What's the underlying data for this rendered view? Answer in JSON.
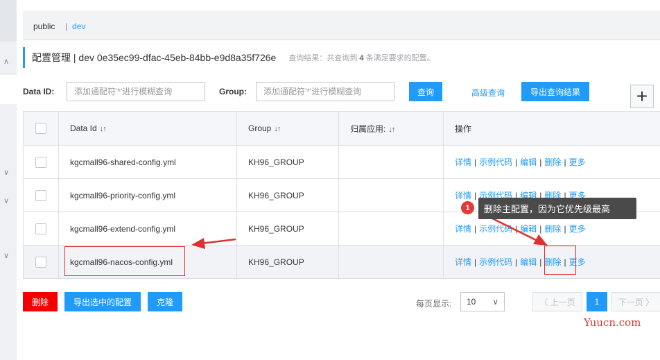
{
  "namespaces": [
    {
      "label": "public"
    },
    {
      "label": "dev"
    }
  ],
  "namespace_separator": "|",
  "title": {
    "text": "配置管理  |  dev  0e35ec99-dfac-45eb-84bb-e9d8a35f726e",
    "hint_prefix": "查询结果：共查询到",
    "hint_count": "4",
    "hint_suffix": "条满足要求的配置。"
  },
  "search": {
    "dataid_label": "Data ID:",
    "dataid_placeholder": "添加通配符'*'进行模糊查询",
    "group_label": "Group:",
    "group_placeholder": "添加通配符'*'进行模糊查询",
    "query_button": "查询",
    "advanced_link": "高级查询",
    "export_button": "导出查询结果",
    "add_button": "+"
  },
  "table": {
    "columns": [
      "Data Id",
      "Group",
      "归属应用:",
      "操作"
    ],
    "sort_icon": "↓↑",
    "rows": [
      {
        "data_id": "kgcmall96-shared-config.yml",
        "group": "KH96_GROUP",
        "app": ""
      },
      {
        "data_id": "kgcmall96-priority-config.yml",
        "group": "KH96_GROUP",
        "app": ""
      },
      {
        "data_id": "kgcmall96-extend-config.yml",
        "group": "KH96_GROUP",
        "app": ""
      },
      {
        "data_id": "kgcmall96-nacos-config.yml",
        "group": "KH96_GROUP",
        "app": ""
      }
    ],
    "ops": {
      "detail": "详情",
      "sample": "示例代码",
      "edit": "编辑",
      "delete": "删除",
      "more": "更多",
      "sep": "|"
    }
  },
  "bottom": {
    "delete_button": "删除",
    "export_selected_button": "导出选中的配置",
    "clone_button": "克隆"
  },
  "pagination": {
    "page_size_label": "每页显示:",
    "page_size_value": "10",
    "prev_label": "〈 上一页",
    "current_page": "1",
    "next_label": "下一页 〉"
  },
  "annotation": {
    "badge": "1",
    "tooltip": "删除主配置，因为它优先级最高",
    "color": "#e03030"
  },
  "watermark": "Yuucn.com",
  "colors": {
    "primary": "#209bfa",
    "danger": "#f50000"
  }
}
